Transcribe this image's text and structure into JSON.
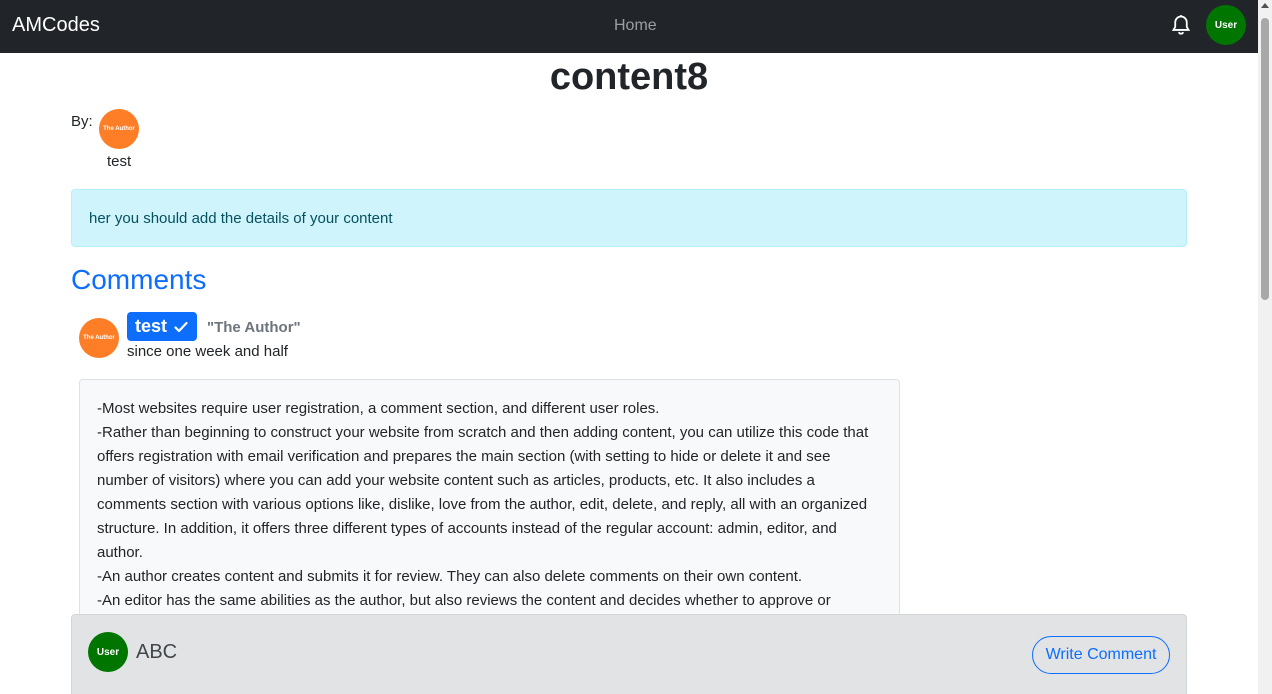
{
  "navbar": {
    "brand": "AMCodes",
    "home": "Home",
    "bell_icon": "bell-icon",
    "avatar_label": "User"
  },
  "content": {
    "title": "content8",
    "by_label": "By:",
    "author_avatar_label": "The Author",
    "author_name": "test",
    "details": "her you should add the details of your content"
  },
  "comments": {
    "heading": "Comments",
    "items": [
      {
        "avatar_label": "The Author",
        "username": "test",
        "verified_icon": "check-icon",
        "role": "\"The Author\"",
        "time": "since one week and half",
        "lines": [
          "-Most websites require user registration, a comment section, and different user roles.",
          "-Rather than beginning to construct your website from scratch and then adding content, you can utilize this code that offers registration with email verification and prepares the main section (with setting to hide or delete it and see number of visitors) where you can add your website content such as articles, products, etc. It also includes a comments section with various options like, dislike, love from the author, edit, delete, and reply, all with an organized structure. In addition, it offers three different types of accounts instead of the regular account: admin, editor, and author.",
          "-An author creates content and submits it for review. They can also delete comments on their own content.",
          "-An editor has the same abilities as the author, but also reviews the content and decides whether to approve or"
        ]
      }
    ]
  },
  "composer": {
    "avatar_label": "User",
    "name": "ABC",
    "button_label": "Write Comment"
  },
  "colors": {
    "navbar_bg": "#212529",
    "accent": "#0d6efd",
    "author_avatar": "#fd7e26",
    "user_avatar": "#007500",
    "alert_bg": "#cff4fc"
  }
}
